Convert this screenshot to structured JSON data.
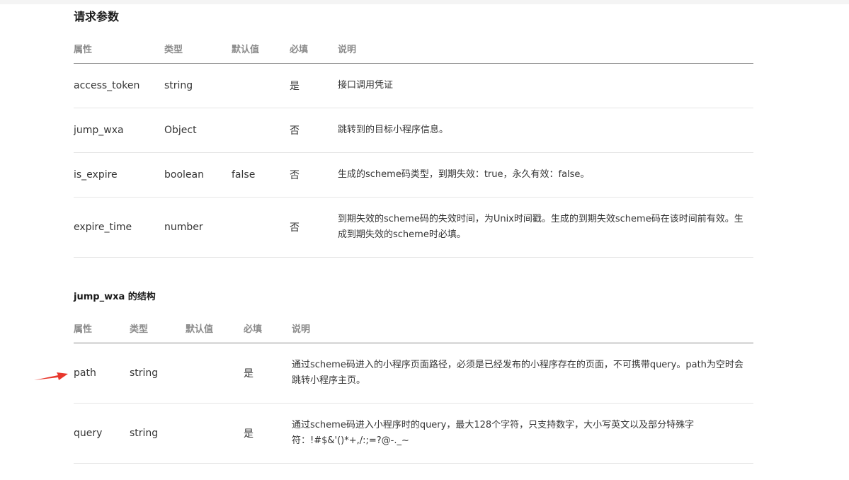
{
  "request_params": {
    "title": "请求参数",
    "headers": [
      "属性",
      "类型",
      "默认值",
      "必填",
      "说明"
    ],
    "rows": [
      {
        "name": "access_token",
        "type": "string",
        "default": "",
        "required": "是",
        "desc": "接口调用凭证"
      },
      {
        "name": "jump_wxa",
        "type": "Object",
        "default": "",
        "required": "否",
        "desc": "跳转到的目标小程序信息。"
      },
      {
        "name": "is_expire",
        "type": "boolean",
        "default": "false",
        "required": "否",
        "desc": "生成的scheme码类型，到期失效：true，永久有效：false。"
      },
      {
        "name": "expire_time",
        "type": "number",
        "default": "",
        "required": "否",
        "desc": "到期失效的scheme码的失效时间，为Unix时间戳。生成的到期失效scheme码在该时间前有效。生成到期失效的scheme时必填。"
      }
    ]
  },
  "jump_wxa_struct": {
    "title": "jump_wxa 的结构",
    "headers": [
      "属性",
      "类型",
      "默认值",
      "必填",
      "说明"
    ],
    "rows": [
      {
        "name": "path",
        "type": "string",
        "default": "",
        "required": "是",
        "desc": "通过scheme码进入的小程序页面路径，必须是已经发布的小程序存在的页面，不可携带query。path为空时会跳转小程序主页。"
      },
      {
        "name": "query",
        "type": "string",
        "default": "",
        "required": "是",
        "desc": "通过scheme码进入小程序时的query，最大128个字符，只支持数字，大小写英文以及部分特殊字符：!#$&'()*+,/:;=?@-._~"
      }
    ]
  },
  "annotation": {
    "arrow_icon": "red-arrow-icon",
    "arrow_color": "#e8372c"
  },
  "colors": {
    "link": "#576b95",
    "header_text": "#8b8b8b",
    "body_text": "#353535"
  }
}
